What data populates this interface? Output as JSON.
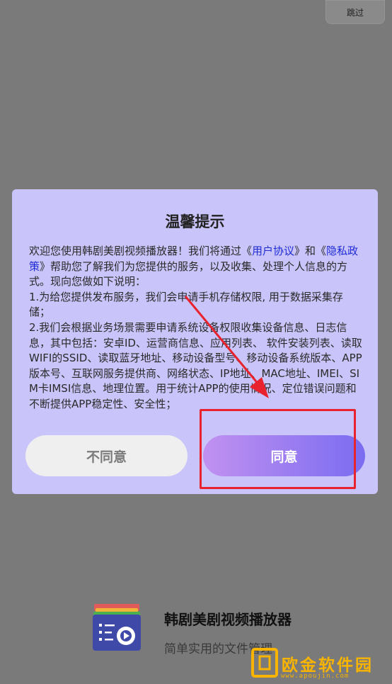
{
  "skip": {
    "label": "跳过"
  },
  "dialog": {
    "title": "温馨提示",
    "body": {
      "p1_before": "欢迎您使用韩剧美剧视频播放器！我们将通过《",
      "link_user": "用户协议",
      "p1_mid": "》和《",
      "link_privacy": "隐私政策",
      "p1_after": "》帮助您了解我们为您提供的服务，以及收集、处理个人信息的方式。现向您做如下说明：",
      "item1": "1.为给您提供发布服务，我们会申请手机存储权限, 用于数据采集存储；",
      "item2": "2.我们会根据业务场景需要申请系统设备权限收集设备信息、日志信息，其中包括：安卓ID、运营商信息、应用列表、 软件安装列表、读取WIFI的SSID、读取蓝牙地址、移动设备型号、移动设备系统版本、APP版本号、互联网服务提供商、网络状态、IP地址、MAC地址、IMEI、SIM卡IMSI信息、地理位置。用于统计APP的使用情况、定位错误问题和不断提供APP稳定性、安全性；"
    },
    "disagree_label": "不同意",
    "agree_label": "同意"
  },
  "app": {
    "name": "韩剧美剧视频播放器",
    "slogan": "简单实用的文件管理",
    "icon": "video-player-gear-icon"
  },
  "watermark": {
    "text": "欧金软件园",
    "url": "www.apoujin.com"
  },
  "colors": {
    "dialog_bg": "#c9c4f9",
    "link": "#1f2cd6",
    "agree_gradient_start": "#c191f0",
    "agree_gradient_end": "#7a6cf1",
    "annotation_red": "#e8232e",
    "watermark_gold": "#f8b400"
  }
}
